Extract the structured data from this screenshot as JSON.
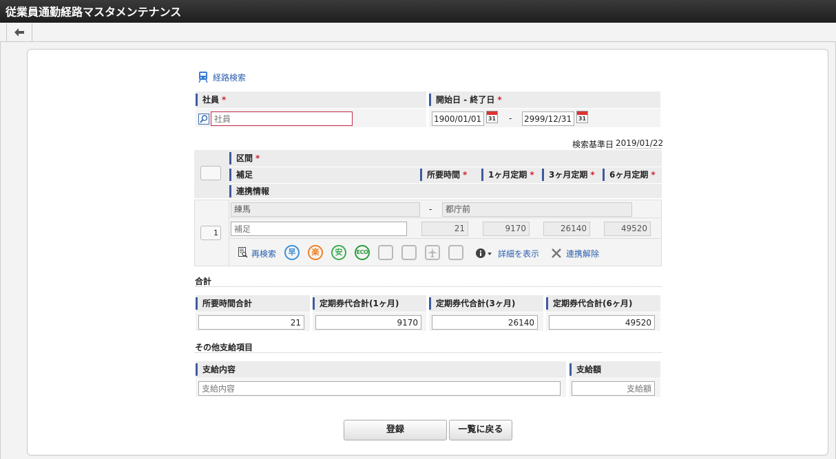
{
  "window": {
    "title": "従業員通勤経路マスタメンテナンス"
  },
  "toolbar": {
    "back_icon": "back-arrow-icon"
  },
  "route_search": {
    "label": "経路検索",
    "icon": "train-icon"
  },
  "employee": {
    "label": "社員",
    "required_mark": "*",
    "placeholder": "社員",
    "icon": "search-icon"
  },
  "period": {
    "label": "開始日 - 終了日",
    "required_mark": "*",
    "start": "1900/01/01",
    "separator": "-",
    "end": "2999/12/31",
    "calendar_num": "31"
  },
  "base_date": {
    "label": "検索基準日",
    "value": "2019/01/22"
  },
  "route_headers": {
    "section": "区間",
    "note": "補足",
    "time": "所要時間",
    "m1": "1ヶ月定期",
    "m3": "3ヶ月定期",
    "m6": "6ヶ月定期",
    "link_info": "連携情報",
    "required_mark": "*"
  },
  "route_row": {
    "number": "1",
    "from": "練馬",
    "dash": "-",
    "to": "都庁前",
    "note_placeholder": "補足",
    "time": "21",
    "m1": "9170",
    "m3": "26140",
    "m6": "49520",
    "research_label": "再検索",
    "modes": [
      "早",
      "楽",
      "安",
      "ECO"
    ],
    "details_label": "詳細を表示",
    "unlink_label": "連携解除"
  },
  "totals": {
    "title": "合計",
    "headers": [
      "所要時間合計",
      "定期券代合計(1ヶ月)",
      "定期券代合計(3ヶ月)",
      "定期券代合計(6ヶ月)"
    ],
    "values": [
      "21",
      "9170",
      "26140",
      "49520"
    ]
  },
  "other": {
    "title": "その他支給項目",
    "content_label": "支給内容",
    "amount_label": "支給額",
    "content_placeholder": "支給内容",
    "amount_placeholder": "支給額"
  },
  "buttons": {
    "register": "登録",
    "back_to_list": "一覧に戻る"
  },
  "colors": {
    "accent": "#3e5a9e",
    "required": "#d0202e",
    "link": "#2a5fb0",
    "mode_fast": "#3a8fd8",
    "mode_easy": "#f08020",
    "mode_cheap": "#3aaa50",
    "mode_eco": "#2a9a3a"
  }
}
